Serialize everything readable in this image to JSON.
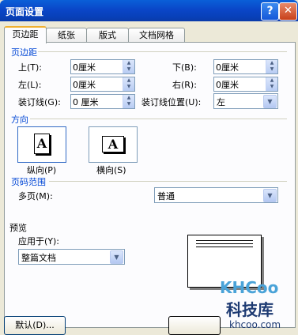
{
  "window": {
    "title": "页面设置",
    "help_symbol": "?",
    "close_symbol": "✕"
  },
  "tabs": [
    "页边距",
    "纸张",
    "版式",
    "文档网格"
  ],
  "margins": {
    "heading": "页边距",
    "top_label": "上(T):",
    "top_value": "0厘米",
    "bottom_label": "下(B):",
    "bottom_value": "0厘米",
    "left_label": "左(L):",
    "left_value": "0厘米",
    "right_label": "右(R):",
    "right_value": "0厘米",
    "gutter_label": "装订线(G):",
    "gutter_value": "0 厘米",
    "gutter_pos_label": "装订线位置(U):",
    "gutter_pos_value": "左"
  },
  "orientation": {
    "heading": "方向",
    "portrait_label": "纵向(P)",
    "landscape_label": "横向(S)",
    "glyph": "A",
    "selected": "portrait"
  },
  "pages": {
    "heading": "页码范围",
    "multi_label": "多页(M):",
    "multi_value": "普通"
  },
  "preview": {
    "heading": "预览",
    "apply_label": "应用于(Y):",
    "apply_value": "整篇文档"
  },
  "footer": {
    "default_button": "默认(D)..."
  },
  "watermark": {
    "logo": "KHCoo",
    "name": "科技库",
    "url": "khcoo.com"
  },
  "icons": {
    "spin": "spin-arrows-icon",
    "dropdown": "dropdown-arrow-icon"
  }
}
